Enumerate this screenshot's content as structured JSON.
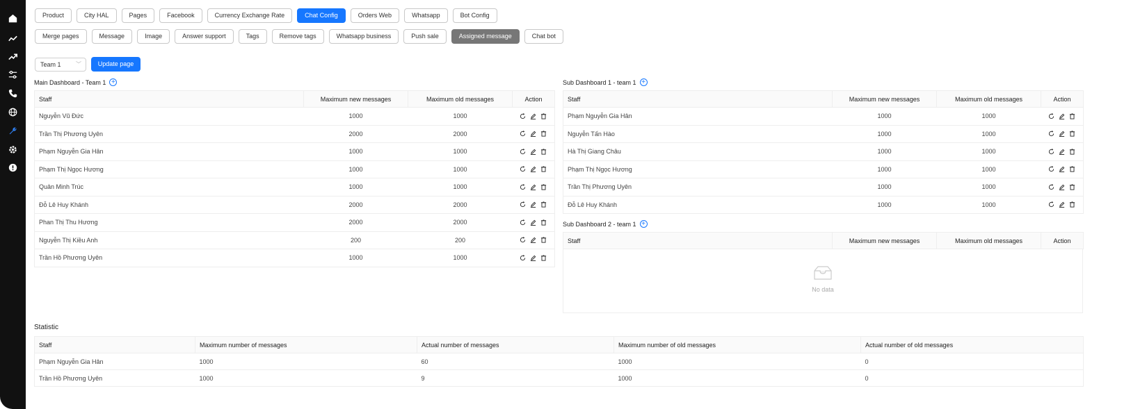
{
  "sidebar": {
    "icons": [
      "home-icon",
      "trend-icon",
      "trend-up-icon",
      "sliders-icon",
      "phone-icon",
      "globe-icon",
      "wrench-icon",
      "gear-icon",
      "info-icon"
    ]
  },
  "tabs_row1": [
    "Product",
    "City HAL",
    "Pages",
    "Facebook",
    "Currency Exchange Rate",
    "Chat Config",
    "Orders Web",
    "Whatsapp",
    "Bot Config"
  ],
  "tabs_row2": [
    "Merge pages",
    "Message",
    "Image",
    "Answer support",
    "Tags",
    "Remove tags",
    "Whatsapp business",
    "Push sale",
    "Assigned message",
    "Chat bot"
  ],
  "team_select": "Team 1",
  "update_button": "Update page",
  "main_dashboard": {
    "title": "Main Dashboard - Team 1",
    "headers": [
      "Staff",
      "Maximum new messages",
      "Maximum old messages",
      "Action"
    ],
    "rows": [
      [
        "Nguyễn Vũ Đức",
        "1000",
        "1000"
      ],
      [
        "Trần Thị Phương Uyên",
        "2000",
        "2000"
      ],
      [
        "Phạm Nguyễn Gia Hân",
        "1000",
        "1000"
      ],
      [
        "Phạm Thị Ngọc Hương",
        "1000",
        "1000"
      ],
      [
        "Quản Minh Trúc",
        "1000",
        "1000"
      ],
      [
        "Đỗ Lê Huy Khánh",
        "2000",
        "2000"
      ],
      [
        "Phan Thị Thu Hương",
        "2000",
        "2000"
      ],
      [
        "Nguyễn Thị Kiều Anh",
        "200",
        "200"
      ],
      [
        "Trần Hồ Phương Uyên",
        "1000",
        "1000"
      ]
    ]
  },
  "sub_dashboard_1": {
    "title": "Sub Dashboard 1 - team 1",
    "headers": [
      "Staff",
      "Maximum new messages",
      "Maximum old messages",
      "Action"
    ],
    "rows": [
      [
        "Phạm Nguyễn Gia Hân",
        "1000",
        "1000"
      ],
      [
        "Nguyễn Tấn Hào",
        "1000",
        "1000"
      ],
      [
        "Hà Thị Giang Châu",
        "1000",
        "1000"
      ],
      [
        "Phạm Thị Ngọc Hương",
        "1000",
        "1000"
      ],
      [
        "Trần Thị Phương Uyên",
        "1000",
        "1000"
      ],
      [
        "Đỗ Lê Huy Khánh",
        "1000",
        "1000"
      ]
    ]
  },
  "sub_dashboard_2": {
    "title": "Sub Dashboard 2 - team 1",
    "headers": [
      "Staff",
      "Maximum new messages",
      "Maximum old messages",
      "Action"
    ],
    "empty_text": "No data"
  },
  "statistic": {
    "title": "Statistic",
    "headers": [
      "Staff",
      "Maximum number of messages",
      "Actual number of messages",
      "Maximum number of old messages",
      "Actual number of old messages"
    ],
    "rows": [
      [
        "Phạm Nguyễn Gia Hân",
        "1000",
        "60",
        "1000",
        "0"
      ],
      [
        "Trần Hồ Phương Uyên",
        "1000",
        "9",
        "1000",
        "0"
      ]
    ]
  }
}
